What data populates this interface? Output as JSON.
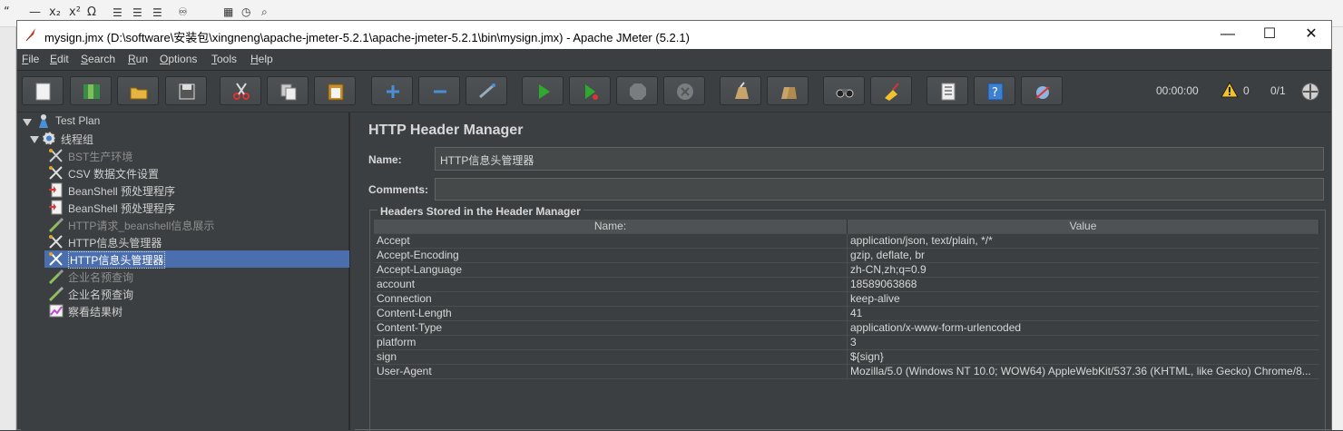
{
  "window": {
    "title": "mysign.jmx (D:\\software\\安装包\\xingneng\\apache-jmeter-5.2.1\\apache-jmeter-5.2.1\\bin\\mysign.jmx) - Apache JMeter (5.2.1)",
    "minimize": "—",
    "maximize": "☐",
    "close": "✕"
  },
  "background_app": {
    "glyphs": [
      "“",
      "—",
      "x₂",
      "x²",
      "Ω"
    ]
  },
  "menu": [
    {
      "underline": "F",
      "rest": "ile"
    },
    {
      "underline": "E",
      "rest": "dit"
    },
    {
      "underline": "S",
      "rest": "earch"
    },
    {
      "underline": "R",
      "rest": "un"
    },
    {
      "underline": "O",
      "rest": "ptions"
    },
    {
      "underline": "T",
      "rest": "ools"
    },
    {
      "underline": "H",
      "rest": "elp"
    }
  ],
  "toolbar": {
    "buttons": [
      "new-icon",
      "templates-icon",
      "open-icon",
      "save-icon",
      "cut-icon",
      "copy-icon",
      "paste-icon",
      "expand-icon",
      "collapse-icon",
      "toggle-icon",
      "start-icon",
      "start-no-pause-icon",
      "stop-icon",
      "shutdown-icon",
      "clear-icon",
      "clear-all-icon",
      "search-icon",
      "reset-search-icon",
      "function-helper-icon",
      "help-icon",
      "remote-icon"
    ],
    "timer": "00:00:00",
    "warnings": "0",
    "threads": "0/1",
    "colors": {
      "start": "#2fa82f",
      "add": "#4a8fd6",
      "remove": "#4a8fd6"
    }
  },
  "tree": {
    "root": "Test Plan",
    "group": "线程组",
    "items": [
      {
        "label": "BST生产环境",
        "icon": "wrench-icon",
        "disabled": true
      },
      {
        "label": "CSV 数据文件设置",
        "icon": "wrench-icon",
        "disabled": false
      },
      {
        "label": "BeanShell 预处理程序",
        "icon": "beanshell-icon",
        "disabled": false
      },
      {
        "label": "BeanShell 预处理程序",
        "icon": "beanshell-icon",
        "disabled": false
      },
      {
        "label": "HTTP请求_beanshell信息展示",
        "icon": "pipette-icon",
        "disabled": true
      },
      {
        "label": "HTTP信息头管理器",
        "icon": "wrench-icon",
        "disabled": false
      },
      {
        "label": "HTTP信息头管理器",
        "icon": "wrench-icon",
        "disabled": false,
        "selected": true
      },
      {
        "label": "企业名预查询",
        "icon": "pipette-icon",
        "disabled": true
      },
      {
        "label": "企业名预查询",
        "icon": "pipette-icon",
        "disabled": false
      },
      {
        "label": "察看结果树",
        "icon": "chart-icon",
        "disabled": false
      }
    ]
  },
  "panel": {
    "title": "HTTP Header Manager",
    "name_label": "Name:",
    "name_value": "HTTP信息头管理器",
    "comments_label": "Comments:",
    "comments_value": "",
    "group_title": "Headers Stored in the Header Manager",
    "columns": [
      "Name:",
      "Value"
    ],
    "rows": [
      [
        "Accept",
        "application/json, text/plain, */*"
      ],
      [
        "Accept-Encoding",
        "gzip, deflate, br"
      ],
      [
        "Accept-Language",
        "zh-CN,zh;q=0.9"
      ],
      [
        "account",
        "18589063868"
      ],
      [
        "Connection",
        "keep-alive"
      ],
      [
        "Content-Length",
        "41"
      ],
      [
        "Content-Type",
        "application/x-www-form-urlencoded"
      ],
      [
        "platform",
        "3"
      ],
      [
        "sign",
        "${sign}"
      ],
      [
        "User-Agent",
        "Mozilla/5.0 (Windows NT 10.0; WOW64) AppleWebKit/537.36 (KHTML, like Gecko) Chrome/8..."
      ]
    ]
  }
}
